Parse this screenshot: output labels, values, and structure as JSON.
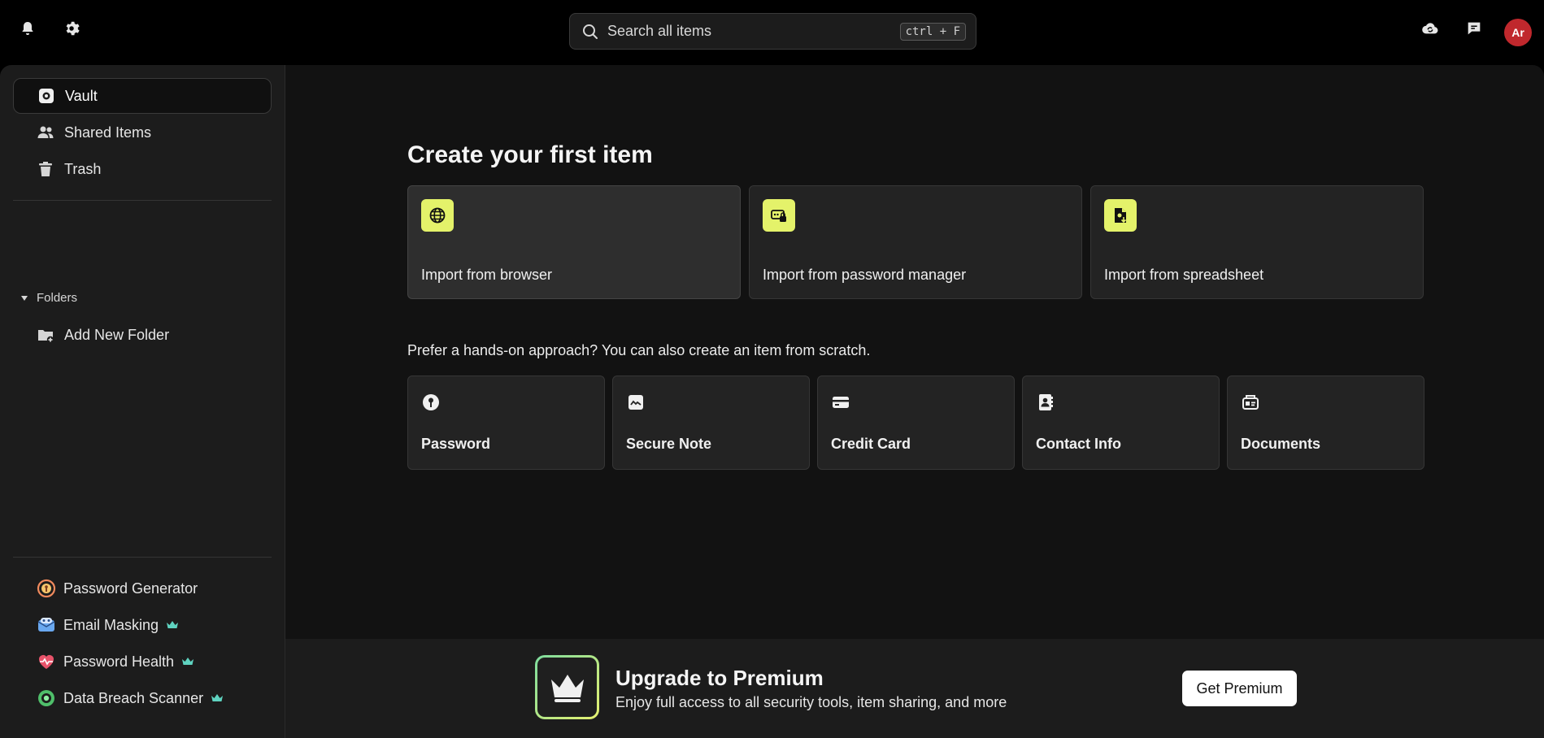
{
  "topbar": {
    "search_placeholder": "Search all items",
    "search_shortcut": "ctrl + F",
    "avatar_initials": "Ar",
    "avatar_color": "#c0282d"
  },
  "sidebar": {
    "nav": [
      {
        "label": "Vault",
        "icon": "vault-icon",
        "active": true
      },
      {
        "label": "Shared Items",
        "icon": "people-icon"
      },
      {
        "label": "Trash",
        "icon": "trash-icon"
      }
    ],
    "folders_label": "Folders",
    "add_folder_label": "Add New Folder",
    "tools": [
      {
        "label": "Password Generator",
        "icon": "password-generator-icon",
        "premium": false
      },
      {
        "label": "Email Masking",
        "icon": "email-masking-icon",
        "premium": true
      },
      {
        "label": "Password Health",
        "icon": "heart-pulse-icon",
        "premium": true
      },
      {
        "label": "Data Breach Scanner",
        "icon": "breach-scanner-icon",
        "premium": true
      }
    ]
  },
  "main": {
    "heading": "Create your first item",
    "imports": [
      {
        "label": "Import from browser",
        "icon": "globe-icon"
      },
      {
        "label": "Import from password manager",
        "icon": "password-manager-icon"
      },
      {
        "label": "Import from spreadsheet",
        "icon": "spreadsheet-import-icon"
      }
    ],
    "subheading": "Prefer a hands-on approach? You can also create an item from scratch.",
    "items": [
      {
        "label": "Password",
        "icon": "key-icon"
      },
      {
        "label": "Secure Note",
        "icon": "note-icon"
      },
      {
        "label": "Credit Card",
        "icon": "credit-card-icon"
      },
      {
        "label": "Contact Info",
        "icon": "contact-icon"
      },
      {
        "label": "Documents",
        "icon": "document-icon"
      }
    ]
  },
  "banner": {
    "title": "Upgrade to Premium",
    "subtitle": "Enjoy full access to all security tools, item sharing, and more",
    "button_label": "Get Premium"
  },
  "colors": {
    "accent_yellow": "#e4f26a",
    "premium_crown": "#5fd3c0",
    "background": "#121212"
  }
}
